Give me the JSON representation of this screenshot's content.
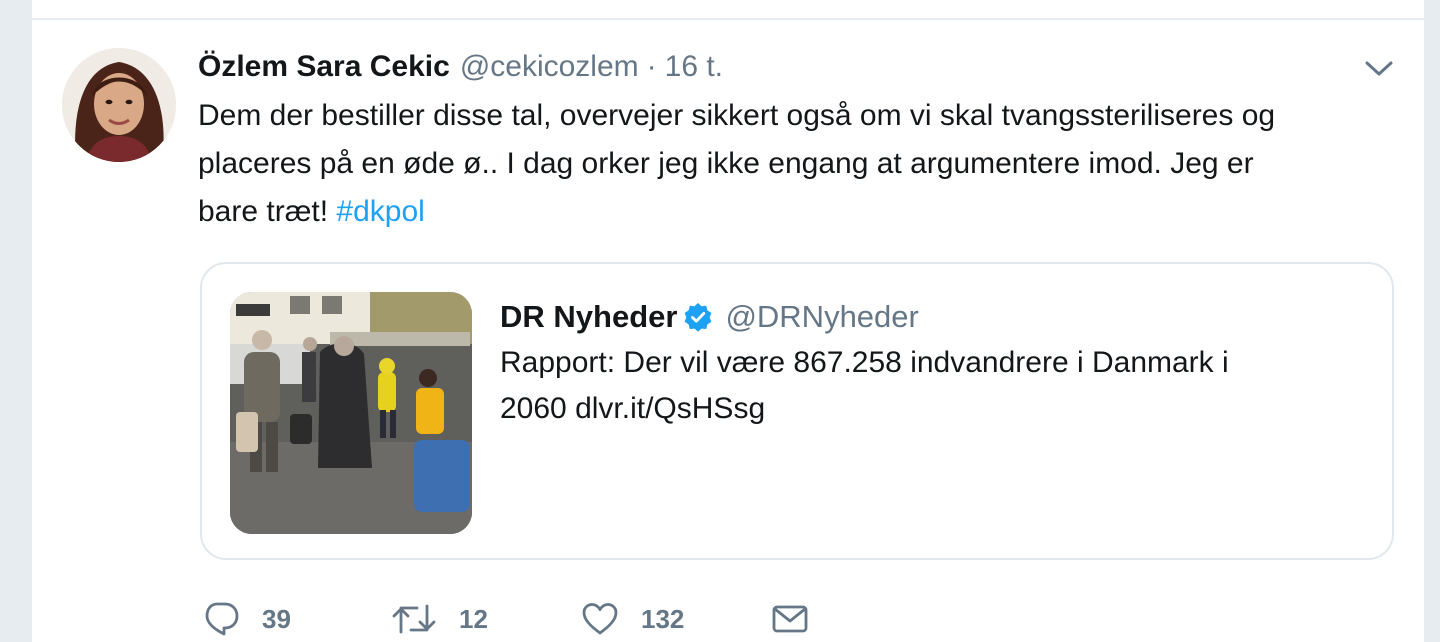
{
  "tweet": {
    "author_name": "Özlem Sara Cekic",
    "author_handle": "@cekicozlem",
    "separator": "·",
    "timestamp": "16 t.",
    "text_line1": "Dem der bestiller disse tal, overvejer sikkert også om vi skal tvangssteriliseres og",
    "text_line2": "placeres på en øde ø.. I dag orker jeg ikke engang at argumentere imod. Jeg er",
    "text_line3_prefix": "bare træt! ",
    "hashtag": "#dkpol",
    "menu_icon": "chevron-down-icon"
  },
  "quoted": {
    "author_name": "DR Nyheder",
    "verified_icon": "verified-badge-icon",
    "author_handle": "@DRNyheder",
    "text_line1": "Rapport: Der vil være 867.258 indvandrere i Danmark i",
    "text_line2": "2060 dlvr.it/QsHSsg"
  },
  "actions": {
    "reply_count": "39",
    "retweet_count": "12",
    "like_count": "132"
  },
  "colors": {
    "link": "#1da1f2",
    "secondary_text": "#657786",
    "border": "#e1e8ed",
    "background": "#e6ecf0"
  }
}
